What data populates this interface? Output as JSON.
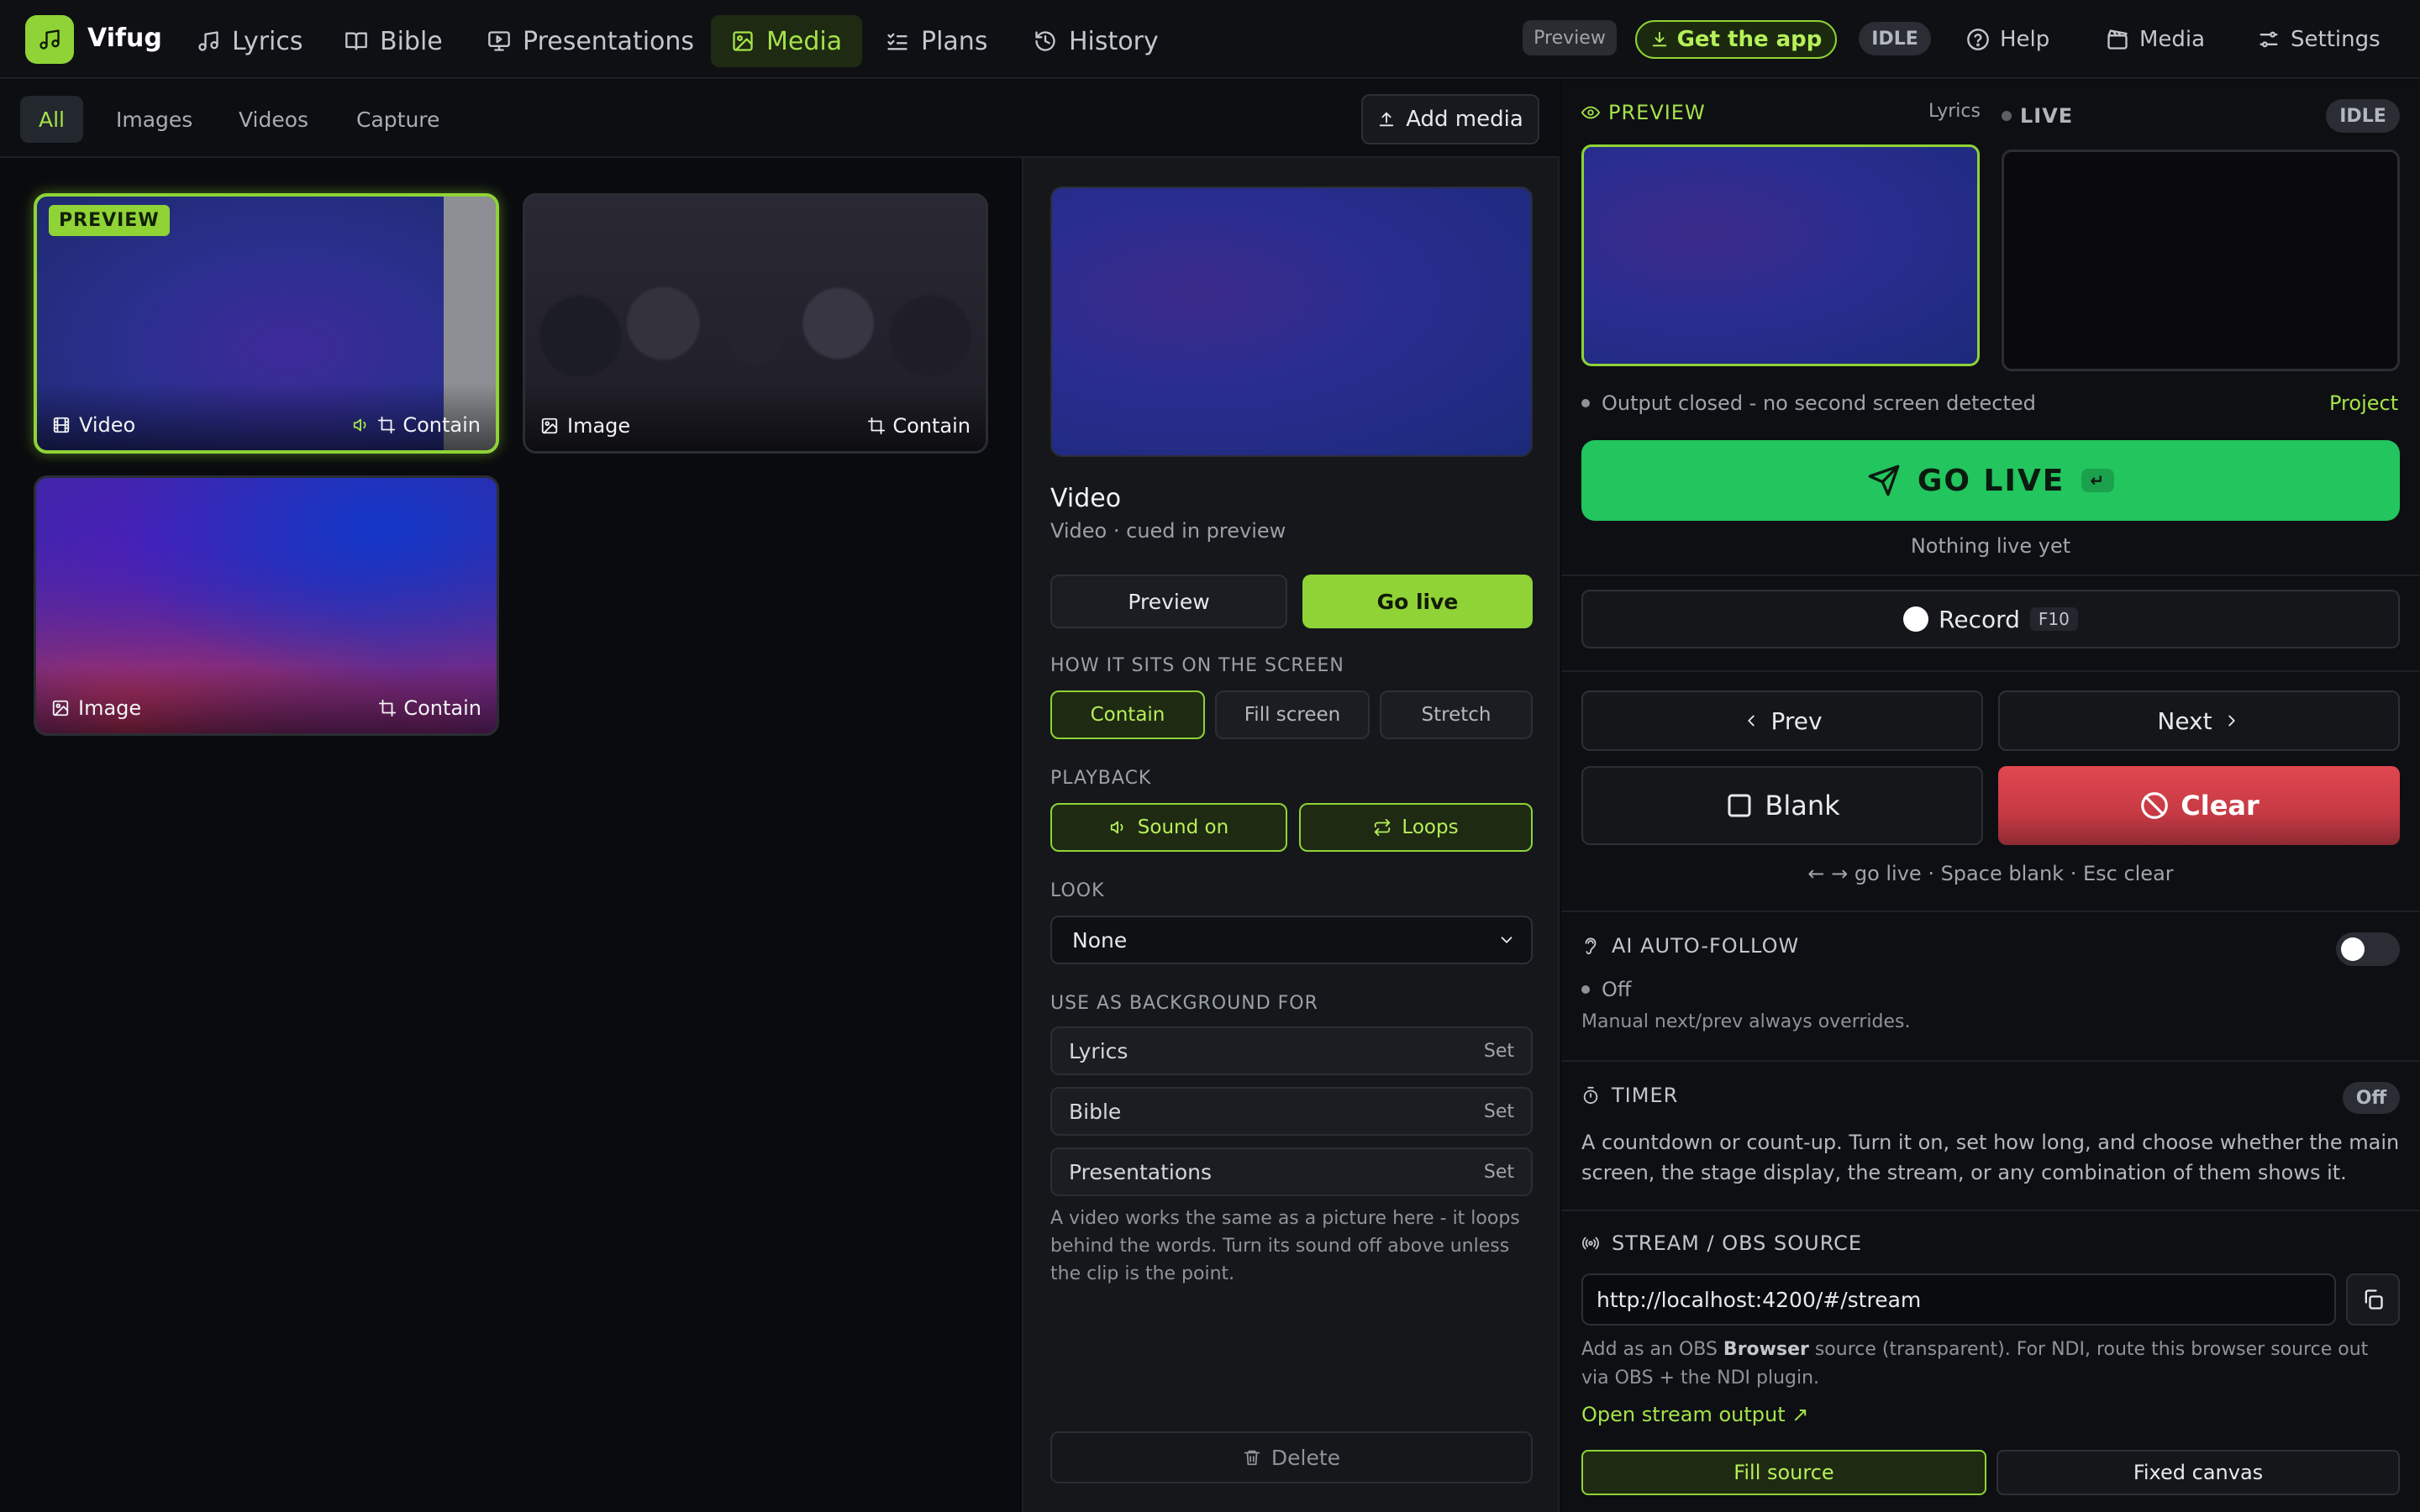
{
  "app": {
    "name": "Vifug"
  },
  "nav": [
    {
      "label": "Lyrics",
      "icon": "music-note-icon"
    },
    {
      "label": "Bible",
      "icon": "book-icon"
    },
    {
      "label": "Presentations",
      "icon": "presentation-icon"
    },
    {
      "label": "Media",
      "icon": "image-icon",
      "active": true
    },
    {
      "label": "Plans",
      "icon": "checklist-icon"
    },
    {
      "label": "History",
      "icon": "history-icon"
    }
  ],
  "topright": {
    "preview_tag": "Preview",
    "get_app": "Get the app",
    "status": "IDLE",
    "help": "Help",
    "media": "Media",
    "settings": "Settings"
  },
  "filters": [
    "All",
    "Images",
    "Videos",
    "Capture"
  ],
  "add_media": "Add media",
  "media": [
    {
      "kind": "Video",
      "fit": "Contain",
      "badge": "PREVIEW",
      "sound": true
    },
    {
      "kind": "Image",
      "fit": "Contain"
    },
    {
      "kind": "Image",
      "fit": "Contain"
    }
  ],
  "detail": {
    "title": "Video",
    "subtitle": "Video · cued in preview",
    "preview_btn": "Preview",
    "golive_btn": "Go live",
    "sit_label": "HOW IT SITS ON THE SCREEN",
    "sit_options": [
      "Contain",
      "Fill screen",
      "Stretch"
    ],
    "playback_label": "PLAYBACK",
    "sound": "Sound on",
    "loops": "Loops",
    "look_label": "LOOK",
    "look_value": "None",
    "bg_label": "USE AS BACKGROUND FOR",
    "bg_rows": [
      {
        "name": "Lyrics",
        "action": "Set"
      },
      {
        "name": "Bible",
        "action": "Set"
      },
      {
        "name": "Presentations",
        "action": "Set"
      }
    ],
    "note": "A video works the same as a picture here - it loops behind the words. Turn its sound off above unless the clip is the point.",
    "delete": "Delete"
  },
  "output": {
    "preview_label": "PREVIEW",
    "preview_source": "Lyrics",
    "live_label": "LIVE",
    "live_status": "IDLE",
    "status_text": "Output closed - no second screen detected",
    "project": "Project",
    "go_live": "GO LIVE",
    "go_live_key": "↵",
    "nothing_live": "Nothing live yet",
    "record": "Record",
    "record_key": "F10",
    "prev": "Prev",
    "next": "Next",
    "blank": "Blank",
    "clear": "Clear",
    "shortcuts": "← → go live · Space blank · Esc clear"
  },
  "autofollow": {
    "label": "AI AUTO-FOLLOW",
    "state": "Off",
    "note": "Manual next/prev always overrides."
  },
  "timer": {
    "label": "TIMER",
    "state": "Off",
    "note": "A countdown or count-up. Turn it on, set how long, and choose whether the main screen, the stage display, the stream, or any combination of them shows it."
  },
  "stream": {
    "label": "STREAM / OBS SOURCE",
    "url": "http://localhost:4200/#/stream",
    "note_a": "Add as an OBS ",
    "note_b": "Browser",
    "note_c": " source (transparent). For NDI, route this browser source out via OBS + the NDI plugin.",
    "open_link": "Open stream output ↗",
    "fill_source": "Fill source",
    "fixed_canvas": "Fixed canvas"
  },
  "colors": {
    "accent": "#8fd336",
    "go_live": "#22c55e",
    "clear": "#d9414c",
    "background": "#0a0b0e"
  }
}
